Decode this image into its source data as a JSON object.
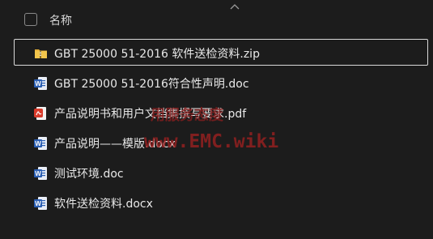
{
  "header": {
    "name_label": "名称"
  },
  "files": [
    {
      "name": "GBT 25000 51-2016 软件送检资料.zip",
      "type": "zip",
      "icon": "folder-zip-icon",
      "selected": true
    },
    {
      "name": "GBT 25000 51-2016符合性声明.doc",
      "type": "doc",
      "icon": "word-icon",
      "selected": false
    },
    {
      "name": "产品说明书和用户文档集撰写要求.pdf",
      "type": "pdf",
      "icon": "pdf-icon",
      "selected": false
    },
    {
      "name": "产品说明——模版.docx",
      "type": "docx",
      "icon": "word-icon",
      "selected": false
    },
    {
      "name": "测试环境.doc",
      "type": "doc",
      "icon": "word-icon",
      "selected": false
    },
    {
      "name": "软件送检资料.docx",
      "type": "docx",
      "icon": "word-icon",
      "selected": false
    }
  ],
  "watermark": {
    "line1": "用服务态度",
    "line2": "www.EMC.wiki"
  },
  "colors": {
    "word": "#2b5fb4",
    "pdf": "#d83b2b",
    "zip": "#e8b23a",
    "watermark": "#a32020"
  }
}
